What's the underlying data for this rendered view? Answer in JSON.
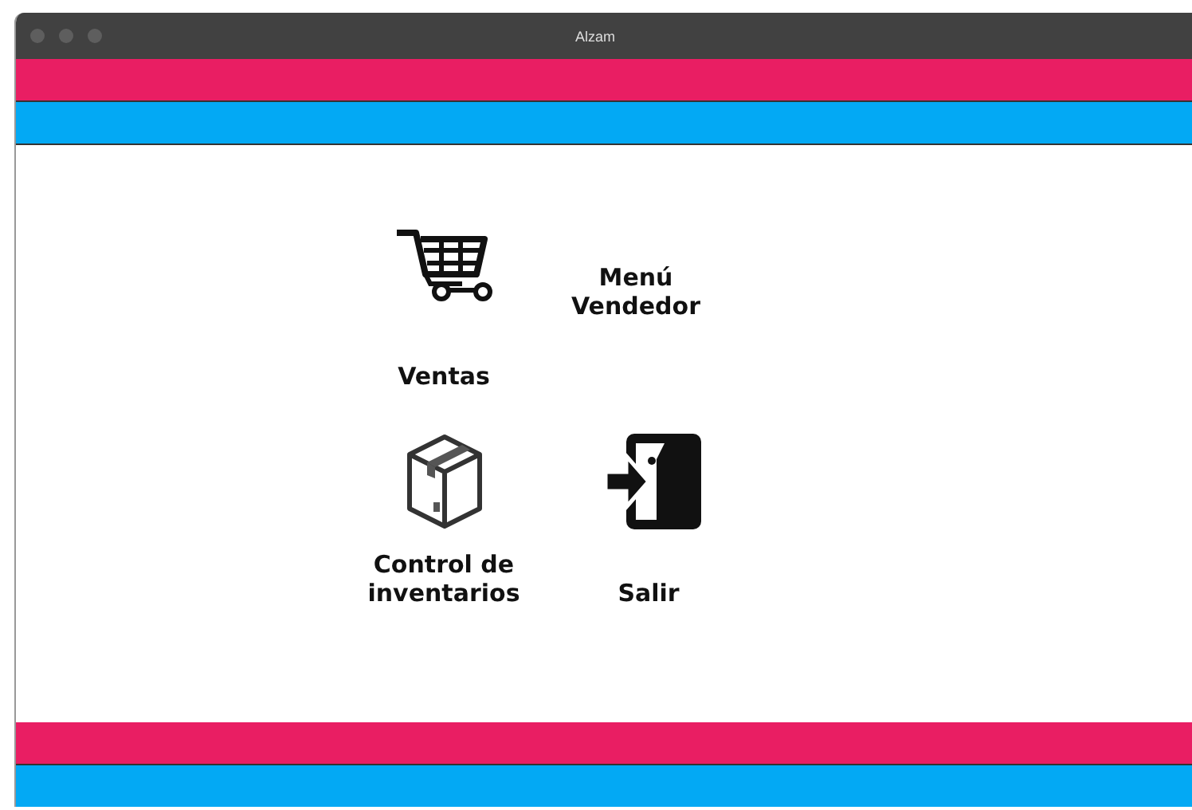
{
  "window": {
    "title": "Alzam"
  },
  "menu": [
    {
      "kind": "cart",
      "label": "Ventas"
    },
    {
      "kind": "text",
      "label": "Menú\nVendedor"
    },
    {
      "kind": "box",
      "label": "Control de\ninventarios"
    },
    {
      "kind": "exit",
      "label": "Salir"
    }
  ]
}
